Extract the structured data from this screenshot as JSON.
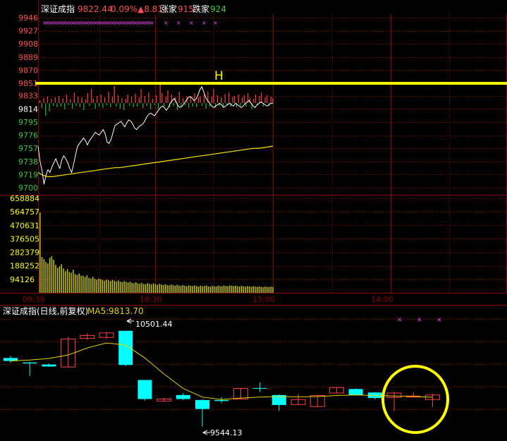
{
  "header": {
    "index_name": "深证成指",
    "last_price": "9822.44",
    "change_pct": "0.09%",
    "change_pts": "▲8.81",
    "up_label": "涨家",
    "up_count": "915",
    "down_label": "跌家",
    "down_count": "924"
  },
  "marker_label": "H",
  "colors": {
    "background": "#000000",
    "grid": "#8b0000",
    "axis_red": "#ff4d4d",
    "axis_green": "#3cc83c",
    "price_line": "#ffffff",
    "avg_line": "#e6d200",
    "volume_bar": "#c8c800",
    "up_bar": "#ff4040",
    "down_bar": "#20c020",
    "highlight": "#ffff00",
    "bear_candle": "#00ffff",
    "bull_candle": "#ff4040",
    "ma5": "#e6d200",
    "magenta": "#ff44ff"
  },
  "chart_data": [
    {
      "type": "line",
      "title": "深证成指 intraday",
      "y_ticks": [
        "9946",
        "9927",
        "9908",
        "9889",
        "9870",
        "9851",
        "9833",
        "9814",
        "9795",
        "9776",
        "9757",
        "9738",
        "9719",
        "9700"
      ],
      "ylim": [
        9700,
        9946
      ],
      "x_ticks": [
        "09:30",
        "10:30",
        "13:00",
        "14:00"
      ],
      "reference_level": 9822.44,
      "highlight_level": 9851,
      "price": [
        9760,
        9738,
        9725,
        9705,
        9718,
        9726,
        9722,
        9730,
        9736,
        9742,
        9734,
        9728,
        9740,
        9746,
        9742,
        9736,
        9728,
        9722,
        9734,
        9748,
        9760,
        9764,
        9768,
        9772,
        9768,
        9762,
        9768,
        9772,
        9776,
        9780,
        9778,
        9776,
        9780,
        9784,
        9778,
        9766,
        9764,
        9770,
        9780,
        9790,
        9792,
        9794,
        9796,
        9792,
        9788,
        9794,
        9798,
        9796,
        9792,
        9786,
        9784,
        9788,
        9790,
        9792,
        9796,
        9802,
        9806,
        9808,
        9806,
        9804,
        9808,
        9812,
        9816,
        9818,
        9816,
        9812,
        9816,
        9822,
        9826,
        9829,
        9824,
        9818,
        9816,
        9818,
        9822,
        9826,
        9830,
        9832,
        9830,
        9826,
        9828,
        9834,
        9842,
        9846,
        9838,
        9830,
        9826,
        9822,
        9818,
        9816,
        9818,
        9820,
        9822,
        9820,
        9816,
        9818,
        9820,
        9822,
        9820,
        9818,
        9822,
        9820,
        9818,
        9816,
        9818,
        9822,
        9824,
        9826,
        9822,
        9818,
        9816,
        9820,
        9822,
        9824,
        9822,
        9820,
        9818,
        9820,
        9822,
        9822
      ],
      "average": [
        9722,
        9718,
        9716,
        9716,
        9717,
        9718,
        9719,
        9720,
        9721,
        9722,
        9723,
        9724,
        9725,
        9726,
        9727,
        9728,
        9729,
        9729,
        9730,
        9731,
        9732,
        9733,
        9734,
        9735,
        9736,
        9737,
        9738,
        9739,
        9740,
        9741,
        9742,
        9743,
        9744,
        9745,
        9746,
        9747,
        9748,
        9749,
        9750,
        9751,
        9752,
        9753,
        9754,
        9755,
        9756,
        9757,
        9757,
        9758,
        9759,
        9760
      ],
      "breadth_bars": [
        4,
        -7,
        7,
        -18,
        9,
        -12,
        6,
        -4,
        8,
        -6,
        10,
        -5,
        7,
        -9,
        12,
        -3,
        6,
        -8,
        15,
        -4,
        9,
        -6,
        8,
        -10,
        5,
        14,
        -4,
        20,
        6,
        -8,
        10,
        -5,
        12,
        -7,
        8,
        -3,
        16,
        -6,
        9,
        24,
        -5,
        11,
        -8,
        7,
        -10,
        6,
        12,
        -4,
        9,
        -6,
        13,
        -5,
        8,
        20,
        -7,
        10,
        -4,
        15,
        -9,
        6,
        -3,
        11,
        -8,
        26,
        14,
        -5,
        9,
        18,
        -6,
        12,
        -4,
        8,
        -10,
        16,
        -5,
        7,
        -3,
        10,
        -7,
        9,
        -5,
        14,
        -6,
        8,
        10,
        -4,
        12,
        -8,
        16,
        -5,
        9,
        20,
        -7,
        11,
        -4,
        8,
        -6,
        13,
        -3,
        15,
        -5,
        9,
        10,
        -6,
        12,
        -4,
        8,
        11,
        -5,
        14,
        7,
        -9,
        6,
        12,
        -3,
        10,
        15,
        -5,
        8,
        11,
        -4,
        9,
        7
      ],
      "volume_ticks": [
        "658884",
        "564757",
        "470631",
        "376505",
        "282379",
        "188252",
        "94126"
      ],
      "volume_ylim": [
        0,
        658884
      ],
      "volume": [
        560000,
        250000,
        235000,
        215000,
        205000,
        245000,
        255000,
        230000,
        195000,
        175000,
        185000,
        200000,
        170000,
        150000,
        165000,
        145000,
        140000,
        160000,
        130000,
        125000,
        135000,
        120000,
        118000,
        110000,
        122000,
        105000,
        100000,
        112000,
        98000,
        92000,
        100000,
        95000,
        90000,
        85000,
        92000,
        88000,
        82000,
        90000,
        84000,
        80000,
        86000,
        78000,
        75000,
        82000,
        76000,
        72000,
        78000,
        70000,
        68000,
        74000,
        66000,
        64000,
        70000,
        62000,
        60000,
        68000,
        63000,
        58000,
        66000,
        60000,
        56000,
        62000,
        58000,
        54000,
        60000,
        55000,
        52000,
        58000,
        54000,
        50000,
        56000,
        52000,
        48000,
        54000,
        50000,
        46000,
        52000,
        49000,
        47000,
        52000,
        48000,
        44000,
        50000,
        46000,
        48000,
        52000,
        45000,
        43000,
        49000,
        46000,
        44000,
        50000,
        47000,
        45000,
        51000,
        48000,
        46000,
        52000,
        49000,
        47000,
        50000,
        46000,
        44000,
        48000,
        45000,
        43000,
        47000,
        45000,
        42000,
        46000,
        44000,
        41000,
        45000,
        42000,
        40000,
        44000,
        42000,
        40000,
        43000,
        41000
      ]
    },
    {
      "type": "candlestick",
      "title": "深证成指(日线,前复权)",
      "indicator_label": "MA5:",
      "indicator_value": "9813.70",
      "annotation_high": "10501.44",
      "annotation_low": "9544.13",
      "ylim": [
        9450,
        10620
      ],
      "candles": [
        {
          "o": 10230,
          "c": 10200,
          "h": 10250,
          "l": 10180
        },
        {
          "o": 10185,
          "c": 10175,
          "h": 10190,
          "l": 10050
        },
        {
          "o": 10165,
          "c": 10145,
          "h": 10175,
          "l": 10140
        },
        {
          "o": 10140,
          "c": 10420,
          "h": 10440,
          "l": 10135
        },
        {
          "o": 10425,
          "c": 10455,
          "h": 10480,
          "l": 10410
        },
        {
          "o": 10435,
          "c": 10480,
          "h": 10490,
          "l": 10420
        },
        {
          "o": 10501.44,
          "c": 10160,
          "h": 10501.44,
          "l": 10150
        },
        {
          "o": 10010,
          "c": 9820,
          "h": 10010,
          "l": 9805
        },
        {
          "o": 9800,
          "c": 9820,
          "h": 9830,
          "l": 9795
        },
        {
          "o": 9860,
          "c": 9820,
          "h": 9880,
          "l": 9810
        },
        {
          "o": 9810,
          "c": 9720,
          "h": 9815,
          "l": 9544.13
        },
        {
          "o": 9810,
          "c": 9800,
          "h": 9840,
          "l": 9780
        },
        {
          "o": 9820,
          "c": 9925,
          "h": 9930,
          "l": 9815
        },
        {
          "o": 9930,
          "c": 9930,
          "h": 9985,
          "l": 9890
        },
        {
          "o": 9860,
          "c": 9760,
          "h": 9865,
          "l": 9700
        },
        {
          "o": 9765,
          "c": 9815,
          "h": 9870,
          "l": 9760
        },
        {
          "o": 9745,
          "c": 9855,
          "h": 9860,
          "l": 9740
        },
        {
          "o": 9880,
          "c": 9935,
          "h": 9940,
          "l": 9875
        },
        {
          "o": 9920,
          "c": 9860,
          "h": 9925,
          "l": 9855
        },
        {
          "o": 9885,
          "c": 9830,
          "h": 9890,
          "l": 9815
        },
        {
          "o": 9835,
          "c": 9880,
          "h": 9890,
          "l": 9700
        },
        {
          "o": 9840,
          "c": 9850,
          "h": 9890,
          "l": 9835
        },
        {
          "o": 9815,
          "c": 9860,
          "h": 9875,
          "l": 9740
        }
      ],
      "ma5": [
        10200,
        10210,
        10225,
        10260,
        10330,
        10380,
        10360,
        10230,
        10070,
        9925,
        9840,
        9815,
        9830,
        9840,
        9845,
        9842,
        9845,
        9855,
        9860,
        9855,
        9850,
        9845,
        9838
      ]
    }
  ]
}
